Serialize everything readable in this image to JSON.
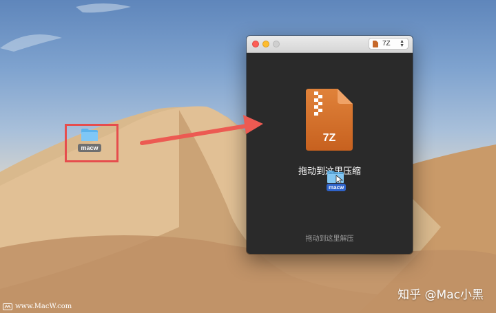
{
  "desktop": {
    "folder_label": "macw"
  },
  "window": {
    "format_select": {
      "value": "7Z"
    },
    "archive_label": "7Z",
    "drop_compress_text": "拖动到这里压缩",
    "drag_item_label": "macw",
    "drop_extract_text": "拖动到这里解压"
  },
  "watermarks": {
    "left": "www.MacW.com",
    "right": "知乎 @Mac小黑"
  },
  "colors": {
    "highlight": "#e64d4d",
    "arrow": "#ec5a52",
    "archive_orange": "#d8752f",
    "window_bg": "#2a2a2a"
  },
  "icons": [
    "folder-icon",
    "archive-7z-icon",
    "arrow-icon",
    "chevron-updown-icon"
  ]
}
